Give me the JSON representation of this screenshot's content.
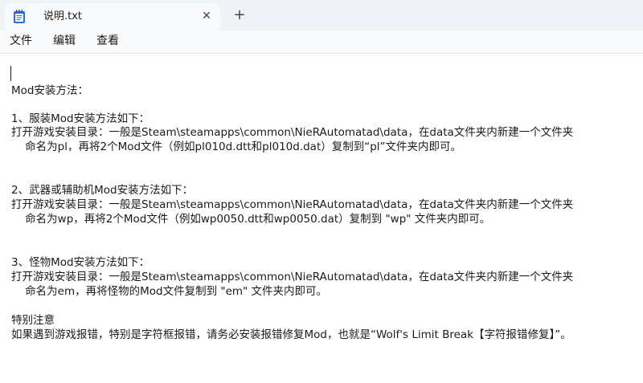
{
  "window": {
    "tab_title": "说明.txt",
    "close_glyph": "✕",
    "new_tab_glyph": "+"
  },
  "menu": {
    "file": "文件",
    "edit": "编辑",
    "view": "查看"
  },
  "document": {
    "lines": [
      "Mod安装方法：",
      "1、服装Mod安装方法如下：",
      "打开游戏安装目录：一般是Steam\\steamapps\\common\\NieRAutomatad\\data，在data文件夹内新建一个文件夹",
      "    命名为pl，再将2个Mod文件（例如pl010d.dtt和pl010d.dat）复制到“pl”文件夹内即可。",
      "2、武器或辅助机Mod安装方法如下：",
      "打开游戏安装目录：一般是Steam\\steamapps\\common\\NieRAutomatad\\data，在data文件夹内新建一个文件夹",
      "    命名为wp，再将2个Mod文件（例如wp0050.dtt和wp0050.dat）复制到 \"wp\" 文件夹内即可。",
      "3、怪物Mod安装方法如下：",
      "打开游戏安装目录：一般是Steam\\steamapps\\common\\NieRAutomatad\\data，在data文件夹内新建一个文件夹",
      "    命名为em，再将怪物的Mod文件复制到 \"em\" 文件夹内即可。",
      "特别注意",
      "如果遇到游戏报错，特别是字符框报错，请务必安装报错修复Mod，也就是“Wolf's Limit Break【字符报错修复】”。"
    ]
  }
}
